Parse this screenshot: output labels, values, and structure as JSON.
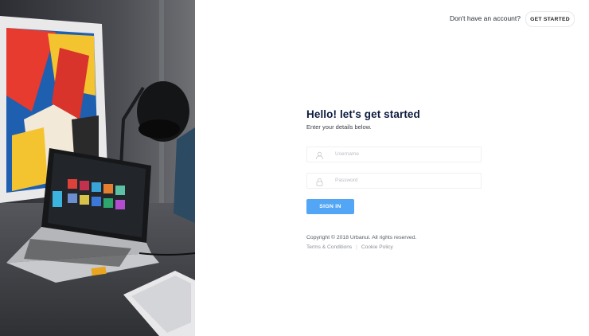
{
  "header": {
    "question": "Don't have an account?",
    "cta_label": "GET STARTED"
  },
  "form": {
    "title": "Hello! let's get started",
    "subtitle": "Enter your details below.",
    "username_placeholder": "Username",
    "password_placeholder": "Password",
    "signin_label": "SIGN IN"
  },
  "footer": {
    "copyright": "Copyright © 2018 Urbanui. All rights reserved.",
    "terms_label": "Terms & Conditions",
    "cookie_label": "Cookie Policy"
  },
  "colors": {
    "accent": "#53a6f5",
    "title": "#0d1b3e"
  }
}
